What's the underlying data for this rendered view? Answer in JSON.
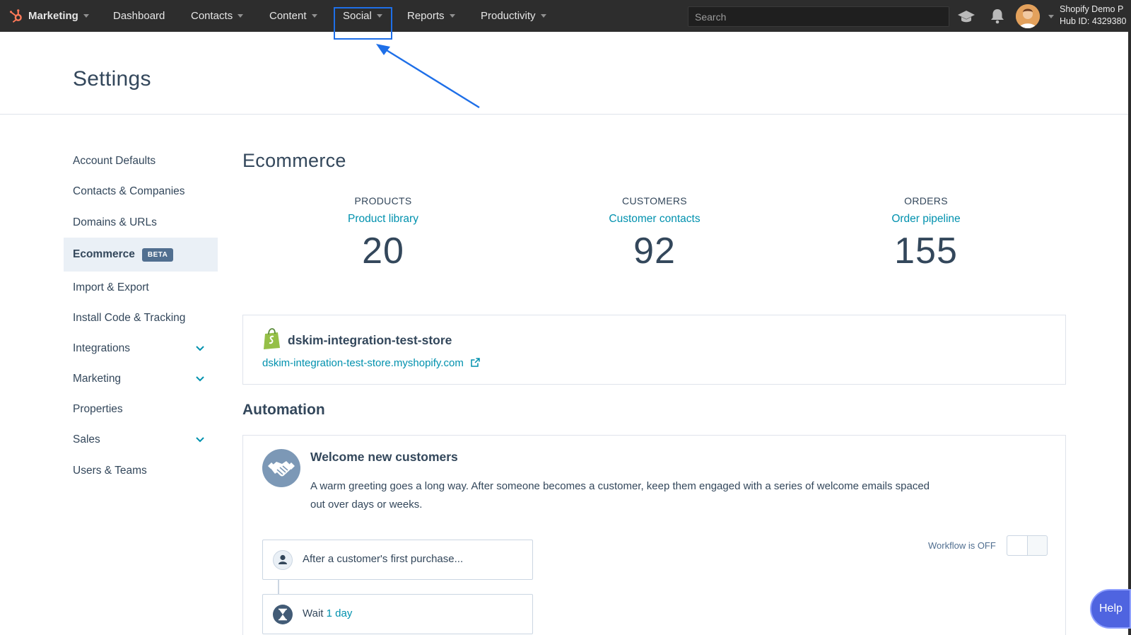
{
  "topnav": {
    "brand_label": "Marketing",
    "items": [
      {
        "label": "Dashboard"
      },
      {
        "label": "Contacts"
      },
      {
        "label": "Content"
      },
      {
        "label": "Social"
      },
      {
        "label": "Reports"
      },
      {
        "label": "Productivity"
      }
    ],
    "search_placeholder": "Search",
    "account_name": "Shopify Demo P",
    "hub_id": "Hub ID: 4329380"
  },
  "colors": {
    "nav_bg": "#2d2d2d",
    "link": "#0091ae",
    "text": "#33475b",
    "annotation": "#1e6fe8",
    "help": "#4f64e0"
  },
  "page": {
    "title": "Settings"
  },
  "sidebar": {
    "items": [
      {
        "label": "Account Defaults"
      },
      {
        "label": "Contacts & Companies"
      },
      {
        "label": "Domains & URLs"
      },
      {
        "label": "Ecommerce",
        "badge": "BETA",
        "active": true
      },
      {
        "label": "Import & Export"
      },
      {
        "label": "Install Code & Tracking"
      },
      {
        "label": "Integrations",
        "expandable": true
      },
      {
        "label": "Marketing",
        "expandable": true
      },
      {
        "label": "Properties"
      },
      {
        "label": "Sales",
        "expandable": true
      },
      {
        "label": "Users & Teams"
      }
    ]
  },
  "main": {
    "section_title": "Ecommerce",
    "stats": [
      {
        "heading": "PRODUCTS",
        "link": "Product library",
        "value": "20"
      },
      {
        "heading": "CUSTOMERS",
        "link": "Customer contacts",
        "value": "92"
      },
      {
        "heading": "ORDERS",
        "link": "Order pipeline",
        "value": "155"
      }
    ],
    "store": {
      "name": "dskim-integration-test-store",
      "url": "dskim-integration-test-store.myshopify.com"
    },
    "automation": {
      "title": "Automation",
      "card": {
        "heading": "Welcome new customers",
        "description": "A warm greeting goes a long way. After someone becomes a customer, keep them engaged with a series of welcome emails spaced out over days or weeks.",
        "workflow_status": "Workflow is OFF",
        "steps": [
          {
            "text": "After a customer's first purchase..."
          },
          {
            "text": "Wait",
            "link": "1 day"
          }
        ]
      }
    }
  },
  "help_label": "Help"
}
